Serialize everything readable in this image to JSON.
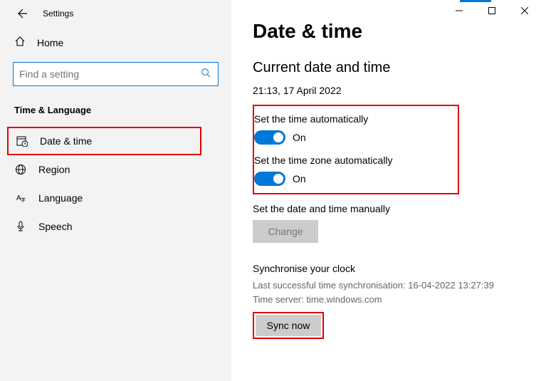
{
  "titlebar": {
    "label": "Settings"
  },
  "home": {
    "label": "Home"
  },
  "search": {
    "placeholder": "Find a setting"
  },
  "category": "Time & Language",
  "nav": {
    "datetime": "Date & time",
    "region": "Region",
    "language": "Language",
    "speech": "Speech"
  },
  "main": {
    "title": "Date & time",
    "subtitle": "Current date and time",
    "now": "21:13, 17 April 2022",
    "auto_time_label": "Set the time automatically",
    "auto_time_state": "On",
    "auto_tz_label": "Set the time zone automatically",
    "auto_tz_state": "On",
    "manual_label": "Set the date and time manually",
    "change_btn": "Change",
    "sync_heading": "Synchronise your clock",
    "sync_last": "Last successful time synchronisation: 16-04-2022 13:27:39",
    "sync_server": "Time server: time.windows.com",
    "sync_btn": "Sync now"
  }
}
